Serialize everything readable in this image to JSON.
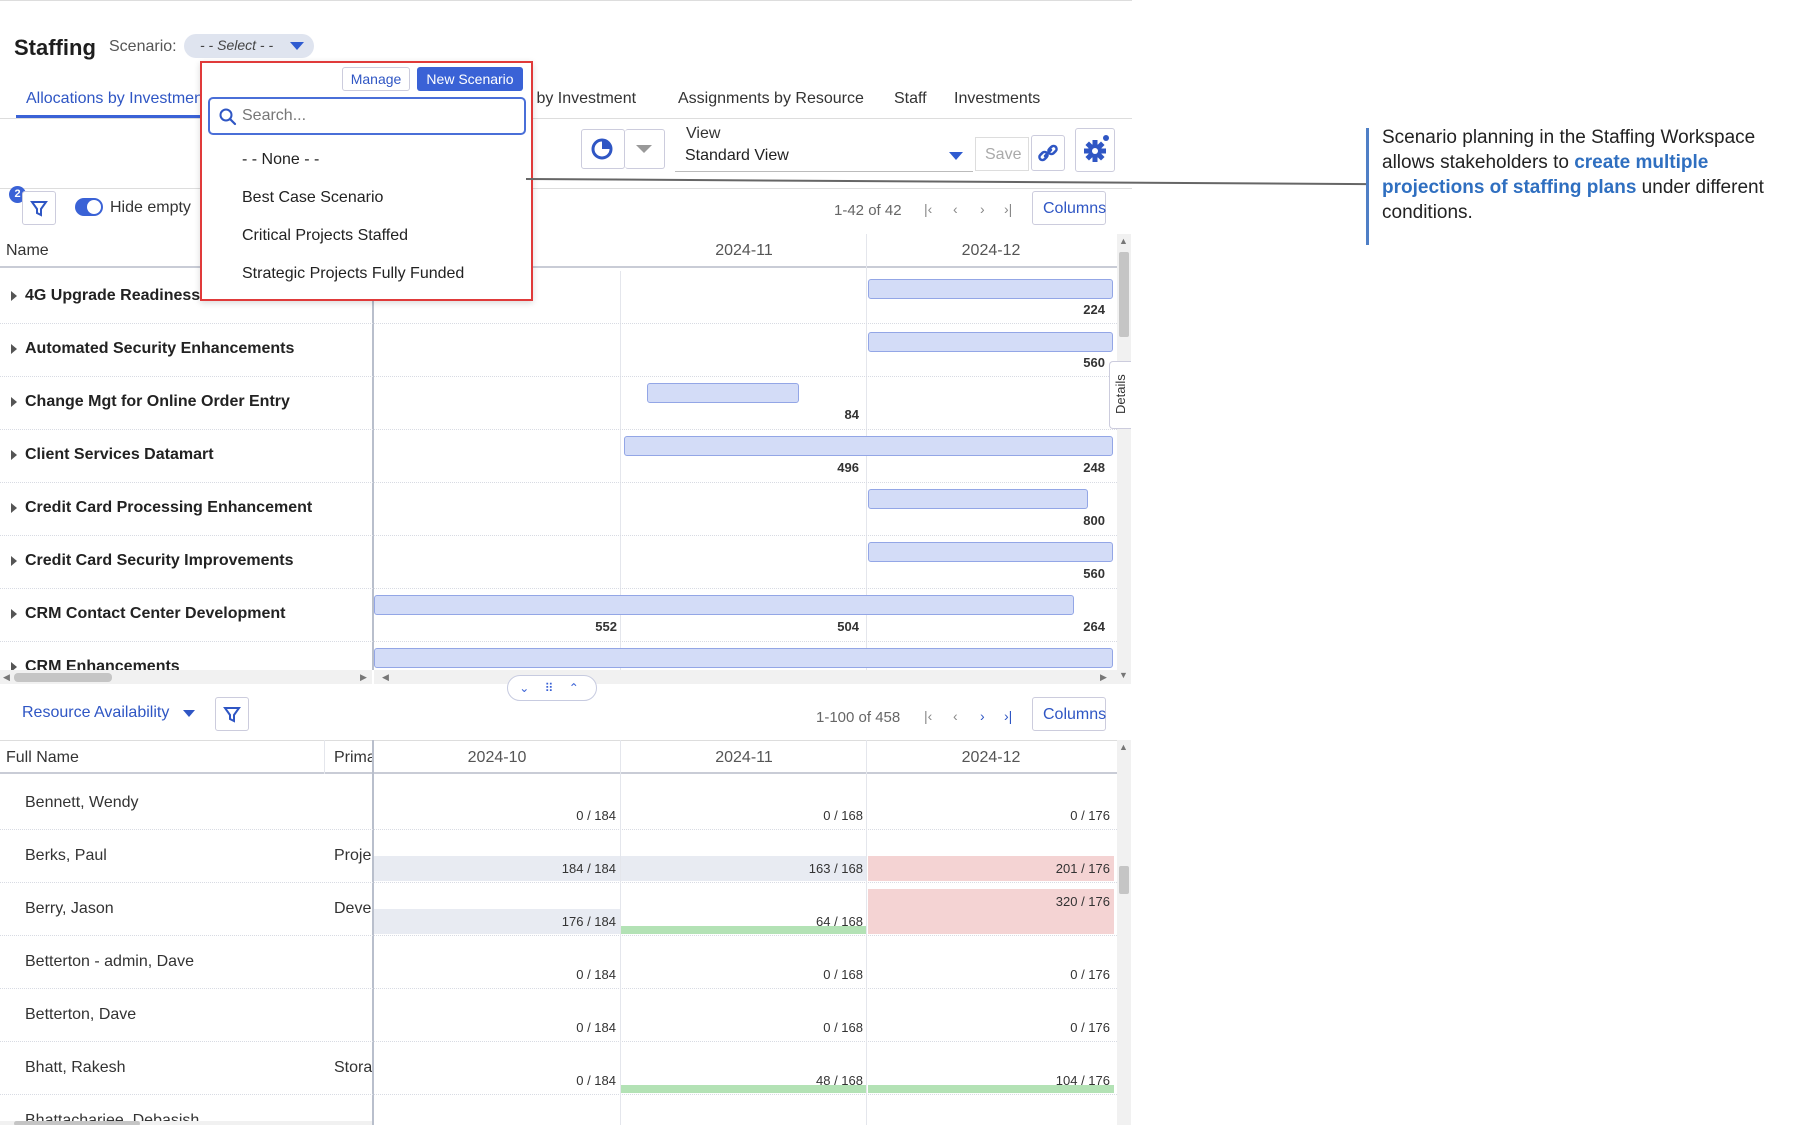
{
  "header": {
    "title": "Staffing",
    "scenario_label": "Scenario:",
    "scenario_value": "- - Select - -"
  },
  "tabs": [
    {
      "label": "Allocations by Investment"
    },
    {
      "label": "s by Investment"
    },
    {
      "label": "Assignments by Resource"
    },
    {
      "label": "Staff"
    },
    {
      "label": "Investments"
    }
  ],
  "toolbar": {
    "view_label": "View",
    "view_value": "Standard View",
    "save_label": "Save"
  },
  "filters": {
    "badge_count": "2",
    "hide_empty_label": "Hide empty"
  },
  "top_grid": {
    "pager": "1-42 of 42",
    "columns_label": "Columns",
    "name_header": "Name",
    "months": [
      "2024-11",
      "2024-12"
    ],
    "details_label": "Details",
    "rows": [
      {
        "name": "4G Upgrade Readiness",
        "n2": "224"
      },
      {
        "name": "Automated Security Enhancements",
        "n2": "560"
      },
      {
        "name": "Change Mgt for Online Order Entry",
        "n1": "84"
      },
      {
        "name": "Client Services Datamart",
        "n1": "496",
        "n2": "248"
      },
      {
        "name": "Credit Card Processing Enhancement",
        "n2": "800"
      },
      {
        "name": "Credit Card Security Improvements",
        "n2": "560"
      },
      {
        "name": "CRM Contact Center Development",
        "n0": "552",
        "n1": "504",
        "n2": "264"
      },
      {
        "name": "CRM Enhancements"
      }
    ]
  },
  "bottom_grid": {
    "title": "Resource Availability",
    "pager": "1-100 of 458",
    "columns_label": "Columns",
    "full_name_header": "Full Name",
    "primary_header": "Prima",
    "months": [
      "2024-10",
      "2024-11",
      "2024-12"
    ],
    "rows": [
      {
        "name": "Bennett, Wendy",
        "role": "",
        "c": [
          "0 / 184",
          "0 / 168",
          "0 / 176"
        ]
      },
      {
        "name": "Berks, Paul",
        "role": "Proje",
        "c": [
          "184 / 184",
          "163 / 168",
          "201 / 176"
        ]
      },
      {
        "name": "Berry, Jason",
        "role": "Devel",
        "c": [
          "176 / 184",
          "64 / 168",
          "320 / 176"
        ]
      },
      {
        "name": "Betterton - admin, Dave",
        "role": "",
        "c": [
          "0 / 184",
          "0 / 168",
          "0 / 176"
        ]
      },
      {
        "name": "Betterton, Dave",
        "role": "",
        "c": [
          "0 / 184",
          "0 / 168",
          "0 / 176"
        ]
      },
      {
        "name": "Bhatt, Rakesh",
        "role": "Stora",
        "c": [
          "0 / 184",
          "48 / 168",
          "104 / 176"
        ]
      },
      {
        "name": "Bhattacharjee, Debasish",
        "role": "",
        "c": [
          "",
          "",
          ""
        ]
      }
    ]
  },
  "dropdown": {
    "manage_label": "Manage",
    "new_label": "New Scenario",
    "search_placeholder": "Search...",
    "items": [
      "- - None - -",
      "Best Case Scenario",
      "Critical Projects Staffed",
      "Strategic Projects Fully Funded"
    ]
  },
  "annotation": {
    "t1": "Scenario planning in the Staffing Workspace allows stakeholders to ",
    "t2": "create multiple projections of staffing plans",
    "t3": " under different conditions."
  },
  "colors": {
    "accent": "#3a62d6",
    "highlight": "#e03a3a",
    "bar": "#d3dcf7",
    "over": "#f4d3d3",
    "under": "#b3e2b5"
  }
}
